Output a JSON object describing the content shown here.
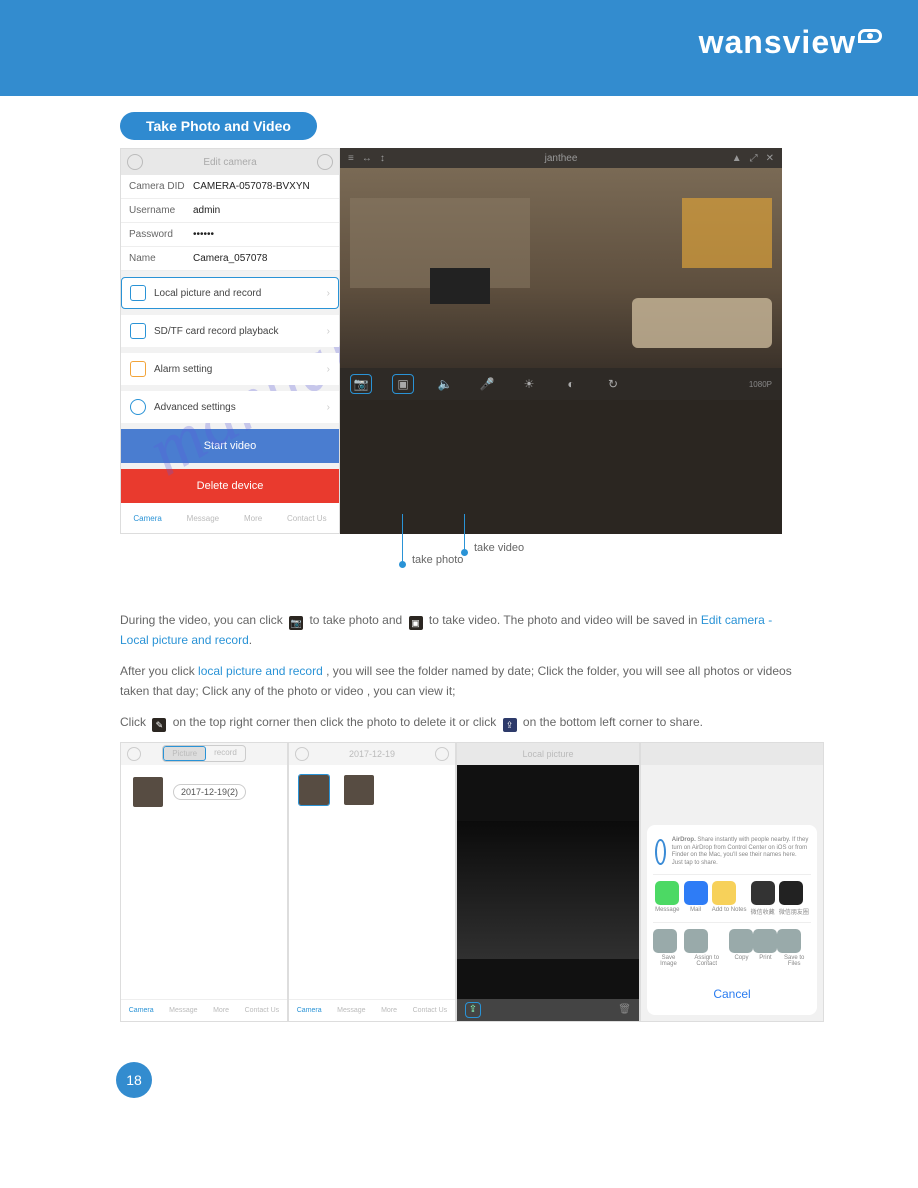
{
  "header": {
    "brand": "wansview"
  },
  "section_title": "Take Photo and Video",
  "edit_camera": {
    "title": "Edit camera",
    "fields": {
      "did_label": "Camera DID",
      "did_value": "CAMERA-057078-BVXYN",
      "user_label": "Username",
      "user_value": "admin",
      "pwd_label": "Password",
      "pwd_value": "••••••",
      "name_label": "Name",
      "name_value": "Camera_057078"
    },
    "options": {
      "local": "Local picture and record",
      "sd": "SD/TF card record playback",
      "alarm": "Alarm setting",
      "adv": "Advanced settings"
    },
    "buttons": {
      "start": "Start video",
      "delete": "Delete device"
    },
    "tabs": {
      "camera": "Camera",
      "message": "Message",
      "more": "More",
      "contact": "Contact Us"
    }
  },
  "live": {
    "title": "janthee",
    "tools": {
      "resolution": "1080P"
    }
  },
  "guide_labels": {
    "photo": "take photo",
    "video": "take video"
  },
  "paragraphs": {
    "p1a": "During the video, you can click ",
    "p1b": " to take photo and ",
    "p1c": " to take video. The photo and video will be saved in",
    "p1_hi": " Edit camera - Local picture and record",
    "p2a": "After you click ",
    "p2b": "local picture and record",
    "p2c": ", you will see the folder named by date; Click the folder, you will see all photos or videos taken that day; Click any of the photo or video , you can view it;",
    "p3": "Click ",
    "p3b": " on the top right corner then click the photo to delete it or click ",
    "p3c": " on the bottom left corner to share."
  },
  "mobile": {
    "seg": {
      "picture": "Picture",
      "record": "record"
    },
    "date": "2017-12-19",
    "folder": "2017-12-19(2)",
    "local_title": "Local picture",
    "tabs": {
      "camera": "Camera",
      "message": "Message",
      "more": "More",
      "contact": "Contact Us"
    }
  },
  "share": {
    "airdrop_title": "AirDrop.",
    "airdrop_text": "Share instantly with people nearby. If they turn on AirDrop from Control Center on iOS or from Finder on the Mac, you'll see their names here. Just tap to share.",
    "apps": {
      "message": "Message",
      "mail": "Mail",
      "notes": "Add to Notes",
      "w1": "微信收藏",
      "w2": "微信朋友圈"
    },
    "actions": {
      "save": "Save Image",
      "assign": "Assign to Contact",
      "copy": "Copy",
      "print": "Print",
      "files": "Save to Files"
    },
    "cancel": "Cancel"
  },
  "page_number": "18",
  "watermark": "manualshive.com"
}
